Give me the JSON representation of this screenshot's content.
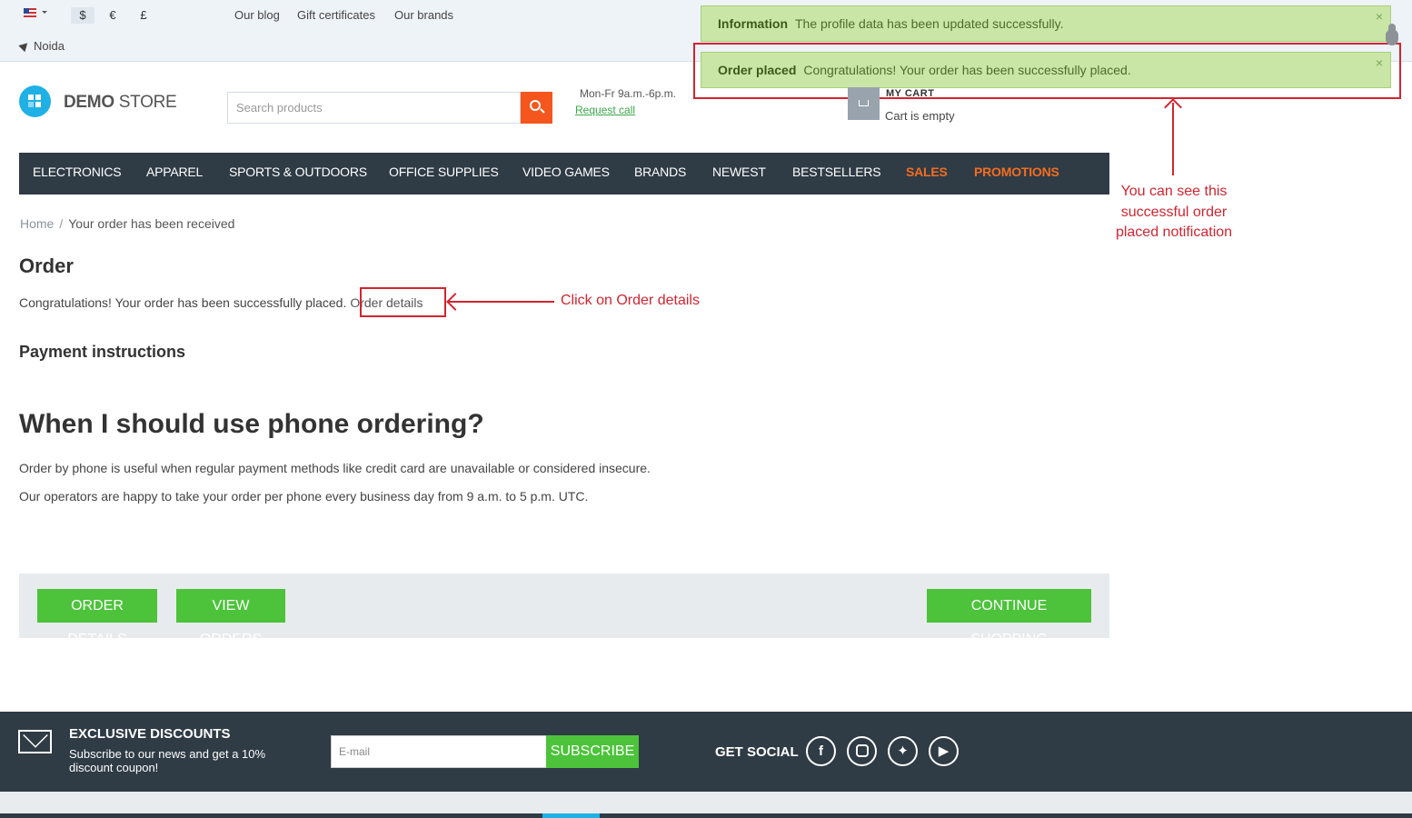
{
  "topbar": {
    "currencies": [
      "$",
      "€",
      "£"
    ],
    "links": [
      "Our blog",
      "Gift certificates",
      "Our brands"
    ],
    "location": "Noida"
  },
  "notifications": [
    {
      "title": "Information",
      "message": "The profile data has been updated successfully.",
      "close": "×"
    },
    {
      "title": "Order placed",
      "message": "Congratulations! Your order has been successfully placed.",
      "close": "×"
    }
  ],
  "header": {
    "logo_bold": "DEMO",
    "logo_light": " STORE",
    "search_placeholder": "Search products",
    "hours": "Mon-Fr 9a.m.-6p.m.",
    "request_call": "Request call",
    "cart_title": "MY CART",
    "cart_status": "Cart is empty"
  },
  "nav": [
    "ELECTRONICS",
    "APPAREL",
    "SPORTS & OUTDOORS",
    "OFFICE SUPPLIES",
    "VIDEO GAMES",
    "BRANDS",
    "NEWEST",
    "BESTSELLERS",
    "SALES",
    "PROMOTIONS"
  ],
  "breadcrumb": {
    "home": "Home",
    "sep": "/",
    "current": "Your order has been received"
  },
  "content": {
    "title": "Order",
    "congrats": "Congratulations! Your order has been successfully placed.",
    "order_details_link": "Order details",
    "payment_heading": "Payment instructions",
    "phone_heading": "When I should use phone ordering?",
    "p1": "Order by phone is useful when regular payment methods like credit card are unavailable or considered insecure.",
    "p2": "Our operators are happy to take your order per phone every business day from 9 a.m. to 5 p.m. UTC."
  },
  "actions": {
    "order_details": "ORDER DETAILS",
    "view_orders": "VIEW ORDERS",
    "continue": "CONTINUE SHOPPING"
  },
  "annotations": {
    "notification_note_1": "You can see this",
    "notification_note_2": "successful order",
    "notification_note_3": "placed notification",
    "click_note": "Click on Order details"
  },
  "footer": {
    "exclusive_title": "EXCLUSIVE DISCOUNTS",
    "exclusive_sub": "Subscribe to our news and get a 10% discount coupon!",
    "email_placeholder": "E-mail",
    "subscribe": "SUBSCRIBE",
    "social_title": "GET SOCIAL",
    "social": [
      "facebook-icon",
      "instagram-icon",
      "twitter-icon",
      "youtube-icon"
    ]
  },
  "colors": {
    "accent_green": "#4cc33a",
    "nav_bg": "#2f3b45",
    "hot": "#f26d21",
    "annotation_red": "#d12531",
    "search_orange": "#f5561d"
  }
}
